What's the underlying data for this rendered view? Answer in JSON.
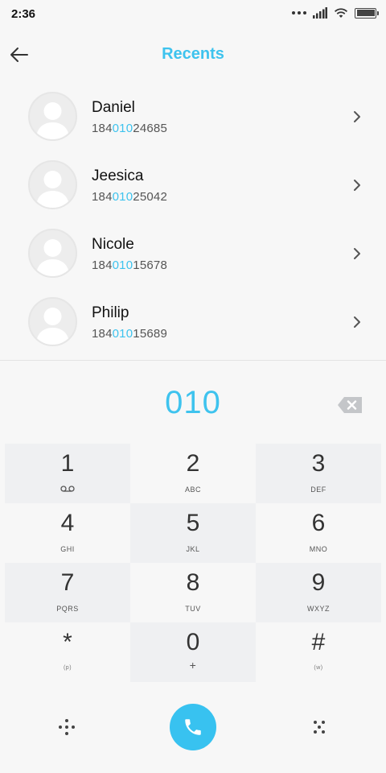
{
  "status_bar": {
    "time": "2:36"
  },
  "header": {
    "title": "Recents",
    "back_icon": "arrow-left-icon"
  },
  "query": "010",
  "contacts": [
    {
      "name": "Daniel",
      "number_prefix": "184",
      "number_match": "010",
      "number_suffix": "24685"
    },
    {
      "name": "Jeesica",
      "number_prefix": "184",
      "number_match": "010",
      "number_suffix": "25042"
    },
    {
      "name": "Nicole",
      "number_prefix": "184",
      "number_match": "010",
      "number_suffix": "15678"
    },
    {
      "name": "Philip",
      "number_prefix": "184",
      "number_match": "010",
      "number_suffix": "15689"
    }
  ],
  "keypad": [
    {
      "digit": "1",
      "sub": "",
      "sub_icon": "voicemail-icon"
    },
    {
      "digit": "2",
      "sub": "ABC"
    },
    {
      "digit": "3",
      "sub": "DEF"
    },
    {
      "digit": "4",
      "sub": "GHI"
    },
    {
      "digit": "5",
      "sub": "JKL"
    },
    {
      "digit": "6",
      "sub": "MNO"
    },
    {
      "digit": "7",
      "sub": "PQRS"
    },
    {
      "digit": "8",
      "sub": "TUV"
    },
    {
      "digit": "9",
      "sub": "WXYZ"
    },
    {
      "digit": "*",
      "sub": "(p)"
    },
    {
      "digit": "0",
      "sub": "+"
    },
    {
      "digit": "#",
      "sub": "(w)"
    }
  ],
  "colors": {
    "accent": "#3ec3ee",
    "call_button": "#38c2f0",
    "key_shade": "#eff0f2"
  },
  "icons": {
    "left_action": "dialpad-dots-icon",
    "call": "phone-icon",
    "right_action": "menu-dots-icon",
    "backspace": "backspace-icon",
    "chevron": "chevron-right-icon",
    "avatar": "person-silhouette-icon"
  }
}
